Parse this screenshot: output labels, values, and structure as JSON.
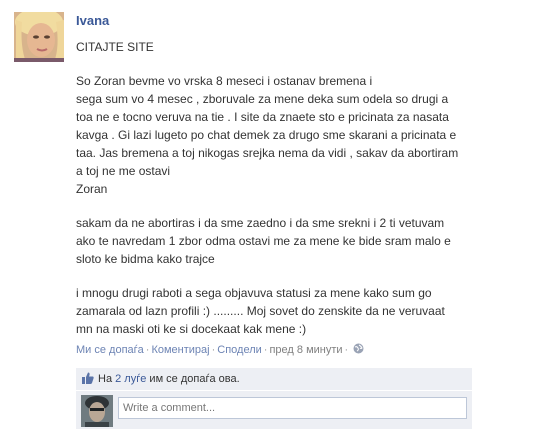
{
  "post": {
    "author": "Ivana",
    "title": "CITAJTE SITE",
    "paragraph1": "So Zoran                    bevme vo vrska 8 meseci i ostanav bremena i\nsega sum vo 4 mesec , zboruvale za mene deka sum odela so drugi a\ntoa ne e tocno veruva na tie . I site da znaete sto e pricinata za nasata\nkavga . Gi lazi lugeto po chat demek za drugo sme skarani a pricinata e\ntaa. Jas bremena a toj nikogas srejka nema da vidi , sakav da abortiram\na toj ne me ostavi\nZoran",
    "paragraph2": "sakam da ne abortiras i da sme zaedno i da sme srekni i 2 ti vetuvam\nako te navredam 1 zbor odma ostavi me za mene ke bide sram malo e\nsloto ke bidma kako trajce",
    "paragraph3": "i mnogu drugi raboti a sega objavuva statusi za mene kako sum go\nzamarala od lazn profili :) ......... Moj sovet do zenskite da ne veruvaat\nmn na maski oti ke si docekaat kak mene :)"
  },
  "actions": {
    "like": "Ми се допаѓа",
    "comment": "Коментирај",
    "share": "Сподели",
    "time": "пред 8 минути",
    "separator": "·"
  },
  "likes": {
    "prefix": "На",
    "count_link": "2 луѓе",
    "suffix": "им се допаѓа ова."
  },
  "comment": {
    "placeholder": "Write a comment..."
  },
  "colors": {
    "link": "#3b5998",
    "action_link": "#6d84b4",
    "box_bg": "#edeff4"
  }
}
